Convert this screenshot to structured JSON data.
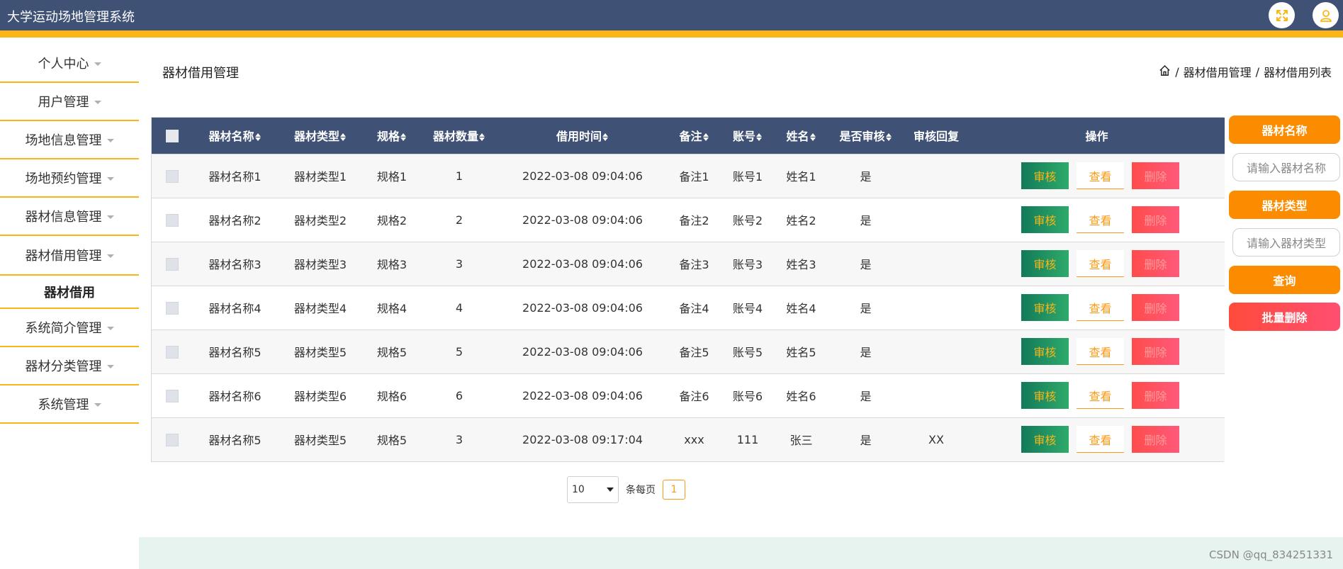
{
  "app": {
    "title": "大学运动场地管理系统"
  },
  "topbar": {
    "icons": [
      "fullscreen-icon",
      "user-icon"
    ],
    "accent": "#fbb516",
    "bg": "#3f5276"
  },
  "sidebar": {
    "items": [
      {
        "label": "个人中心"
      },
      {
        "label": "用户管理"
      },
      {
        "label": "场地信息管理"
      },
      {
        "label": "场地预约管理"
      },
      {
        "label": "器材信息管理"
      },
      {
        "label": "器材借用管理"
      }
    ],
    "subitem": "器材借用",
    "items2": [
      {
        "label": "系统简介管理"
      },
      {
        "label": "器材分类管理"
      },
      {
        "label": "系统管理"
      }
    ]
  },
  "page": {
    "title": "器材借用管理"
  },
  "breadcrumb": {
    "level1": "器材借用管理",
    "sep": "/",
    "level2": "器材借用列表"
  },
  "table": {
    "headers": [
      "器材名称",
      "器材类型",
      "规格",
      "器材数量",
      "借用时间",
      "备注",
      "账号",
      "姓名",
      "是否审核",
      "审核回复",
      "操作"
    ],
    "rows": [
      {
        "name": "器材名称1",
        "type": "器材类型1",
        "spec": "规格1",
        "qty": "1",
        "time": "2022-03-08 09:04:06",
        "note": "备注1",
        "account": "账号1",
        "person": "姓名1",
        "audited": "是",
        "reply": ""
      },
      {
        "name": "器材名称2",
        "type": "器材类型2",
        "spec": "规格2",
        "qty": "2",
        "time": "2022-03-08 09:04:06",
        "note": "备注2",
        "account": "账号2",
        "person": "姓名2",
        "audited": "是",
        "reply": ""
      },
      {
        "name": "器材名称3",
        "type": "器材类型3",
        "spec": "规格3",
        "qty": "3",
        "time": "2022-03-08 09:04:06",
        "note": "备注3",
        "account": "账号3",
        "person": "姓名3",
        "audited": "是",
        "reply": ""
      },
      {
        "name": "器材名称4",
        "type": "器材类型4",
        "spec": "规格4",
        "qty": "4",
        "time": "2022-03-08 09:04:06",
        "note": "备注4",
        "account": "账号4",
        "person": "姓名4",
        "audited": "是",
        "reply": ""
      },
      {
        "name": "器材名称5",
        "type": "器材类型5",
        "spec": "规格5",
        "qty": "5",
        "time": "2022-03-08 09:04:06",
        "note": "备注5",
        "account": "账号5",
        "person": "姓名5",
        "audited": "是",
        "reply": ""
      },
      {
        "name": "器材名称6",
        "type": "器材类型6",
        "spec": "规格6",
        "qty": "6",
        "time": "2022-03-08 09:04:06",
        "note": "备注6",
        "account": "账号6",
        "person": "姓名6",
        "audited": "是",
        "reply": ""
      },
      {
        "name": "器材名称5",
        "type": "器材类型5",
        "spec": "规格5",
        "qty": "3",
        "time": "2022-03-08 09:17:04",
        "note": "xxx",
        "account": "111",
        "person": "张三",
        "audited": "是",
        "reply": "XX"
      }
    ],
    "actions": {
      "audit": "审核",
      "view": "查看",
      "delete": "删除"
    }
  },
  "pager": {
    "page_size": "10",
    "per_page_label": "条每页",
    "current_page": "1"
  },
  "search": {
    "name_label": "器材名称",
    "name_placeholder": "请输入器材名称",
    "type_label": "器材类型",
    "type_placeholder": "请输入器材类型",
    "query_label": "查询",
    "bulk_delete_label": "批量删除"
  },
  "watermark": "CSDN @qq_834251331"
}
